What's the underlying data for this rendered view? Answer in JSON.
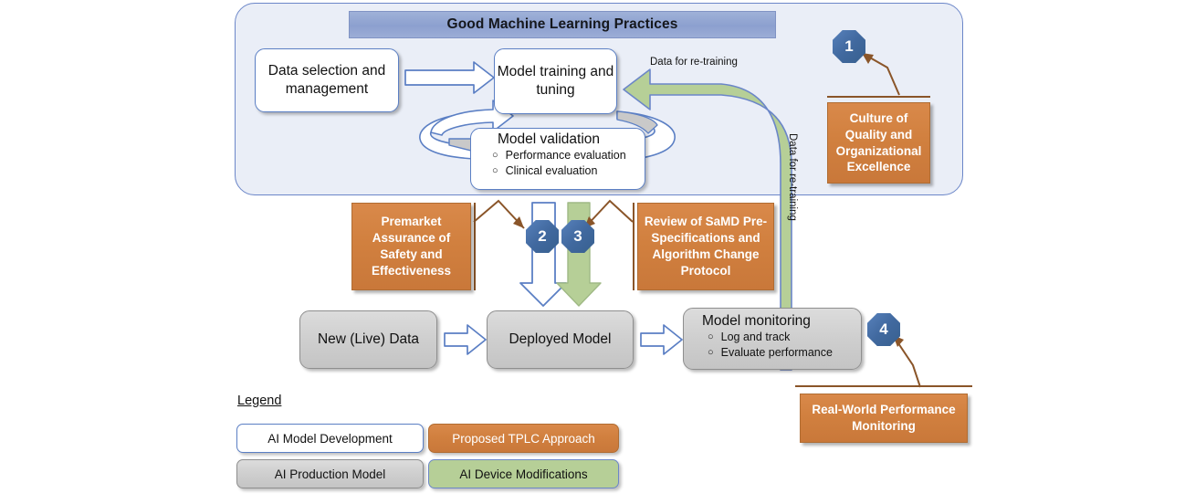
{
  "gmlp": {
    "title": "Good Machine Learning Practices",
    "data_selection": "Data selection and management",
    "model_training": "Model training and tuning",
    "model_validation": {
      "title": "Model validation",
      "bullets": [
        "Performance evaluation",
        "Clinical evaluation"
      ]
    }
  },
  "flow_labels": {
    "data_for_retraining_horizontal": "Data for re-training",
    "data_for_retraining_vertical": "Data for re-training"
  },
  "production": {
    "new_live_data": "New (Live) Data",
    "deployed_model": "Deployed  Model",
    "model_monitoring": {
      "title": "Model monitoring",
      "bullets": [
        "Log and track",
        "Evaluate performance"
      ]
    }
  },
  "tplc_boxes": {
    "culture": "Culture of Quality and Organizational Excellence",
    "premarket": "Premarket Assurance of Safety and Effectiveness",
    "samd_review": "Review of SaMD Pre-Specifications and Algorithm Change Protocol",
    "real_world": "Real-World Performance Monitoring"
  },
  "callouts": {
    "one": "1",
    "two": "2",
    "three": "3",
    "four": "4"
  },
  "legend": {
    "title": "Legend",
    "items": [
      {
        "label": "AI Model Development",
        "swatch": "#ffffff"
      },
      {
        "label": "Proposed TPLC Approach",
        "swatch": "#d1803f"
      },
      {
        "label": "AI Production Model",
        "swatch": "#cfcfcf"
      },
      {
        "label": "AI Device Modifications",
        "swatch": "#b6cf97"
      }
    ]
  },
  "colors": {
    "container_fill": "#eaeef7",
    "container_border": "#6b86c8",
    "banner": "#8ca0cf",
    "orange": "#d1803f",
    "green": "#b6cf97",
    "gray": "#cfcfcf",
    "badge_blue": "#41699f",
    "connector_brown": "#8a5529",
    "arrow_blue": "#5b7fc4"
  }
}
